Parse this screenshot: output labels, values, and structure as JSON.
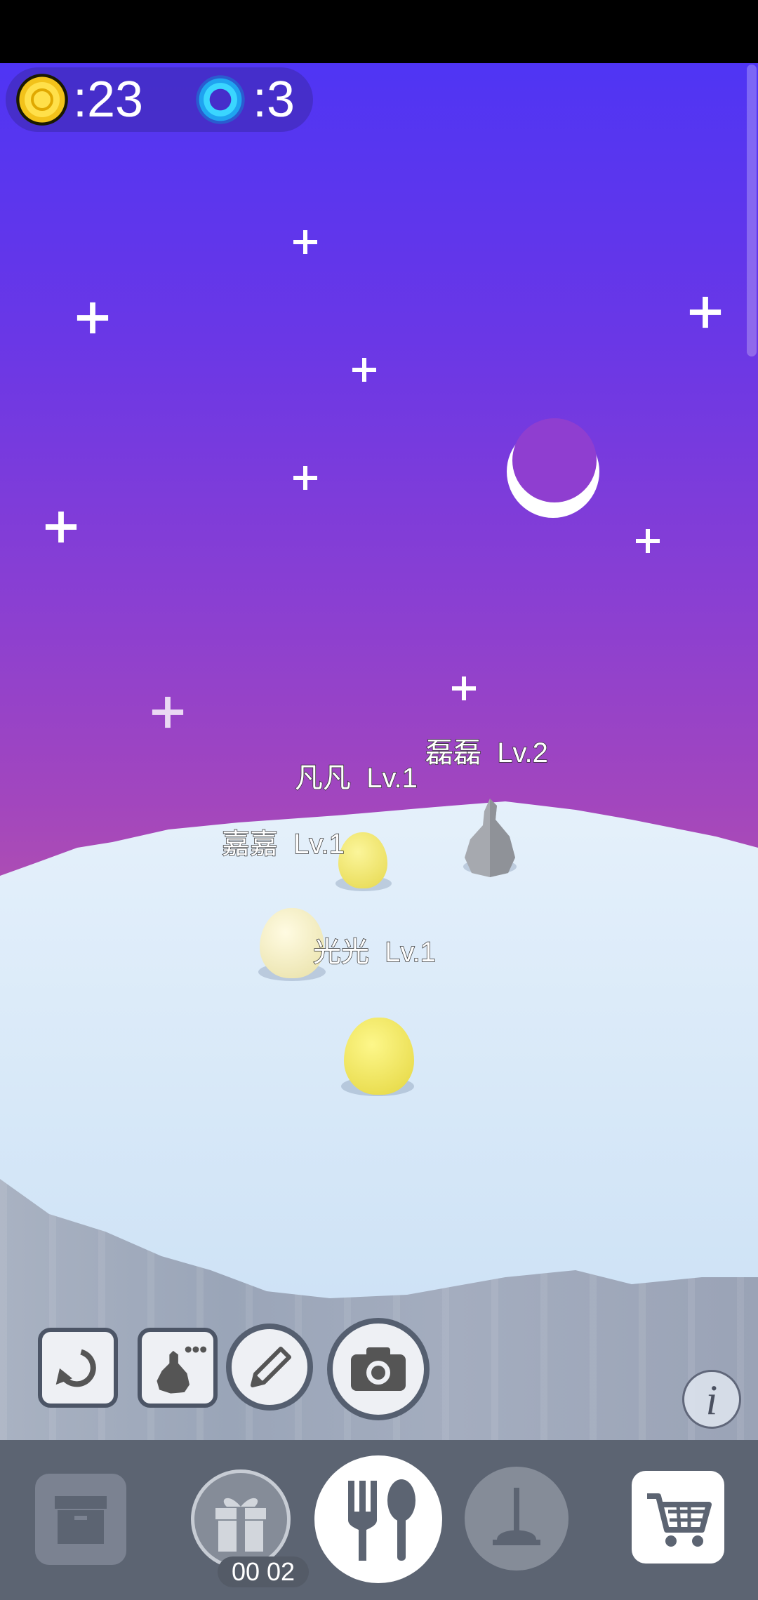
{
  "hud": {
    "coins": ":23",
    "gems": ":3",
    "coin_icon": "gold-coin-icon",
    "gem_icon": "blue-gem-icon"
  },
  "pets": [
    {
      "name": "磊磊",
      "level": "Lv.2",
      "color": "#a8abb1"
    },
    {
      "name": "凡凡",
      "level": "Lv.1",
      "color": "#f3ea72"
    },
    {
      "name": "嘉嘉",
      "level": "Lv.1",
      "color": "#f6f0c4"
    },
    {
      "name": "光光",
      "level": "Lv.1",
      "color": "#f7ef6a"
    }
  ],
  "tools": [
    "rotate-icon",
    "pet-chat-icon",
    "pencil-icon",
    "camera-icon"
  ],
  "info_label": "i",
  "bottom_bar": {
    "items": [
      "storage-box-icon",
      "gift-icon",
      "fork-spoon-icon",
      "plunger-icon",
      "cart-icon"
    ],
    "gift_timer": "00 02"
  },
  "colors": {
    "sky_top": "#4f35f4",
    "sky_bottom": "#b04fb0",
    "snow": "#d7e8f8",
    "bar": "#5c6472"
  }
}
